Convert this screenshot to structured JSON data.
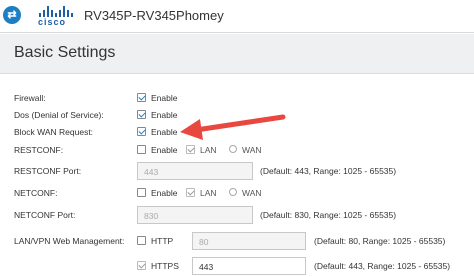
{
  "header": {
    "brand_word": "cisco",
    "device_name": "RV345P-RV345Phomey"
  },
  "section": {
    "title": "Basic Settings"
  },
  "settings": {
    "firewall": {
      "label": "Firewall:",
      "enable": "Enable"
    },
    "dos": {
      "label": "Dos (Denial of Service):",
      "enable": "Enable"
    },
    "block_wan": {
      "label": "Block WAN Request:",
      "enable": "Enable"
    },
    "restconf": {
      "label": "RESTCONF:",
      "enable": "Enable",
      "lan": "LAN",
      "wan": "WAN"
    },
    "restconf_port": {
      "label": "RESTCONF Port:",
      "value": "443",
      "hint": "(Default: 443, Range: 1025 - 65535)"
    },
    "netconf": {
      "label": "NETCONF:",
      "enable": "Enable",
      "lan": "LAN",
      "wan": "WAN"
    },
    "netconf_port": {
      "label": "NETCONF Port:",
      "value": "830",
      "hint": "(Default: 830, Range: 1025 - 65535)"
    },
    "web_mgmt": {
      "label": "LAN/VPN Web Management:",
      "http": "HTTP",
      "http_port": "80",
      "http_hint": "(Default: 80, Range: 1025 - 65535)",
      "https": "HTTPS",
      "https_port": "443",
      "https_hint": "(Default: 443, Range: 1025 - 65535)"
    }
  },
  "colors": {
    "accent": "#1e7ec4",
    "annotation_arrow": "#e8483f"
  }
}
